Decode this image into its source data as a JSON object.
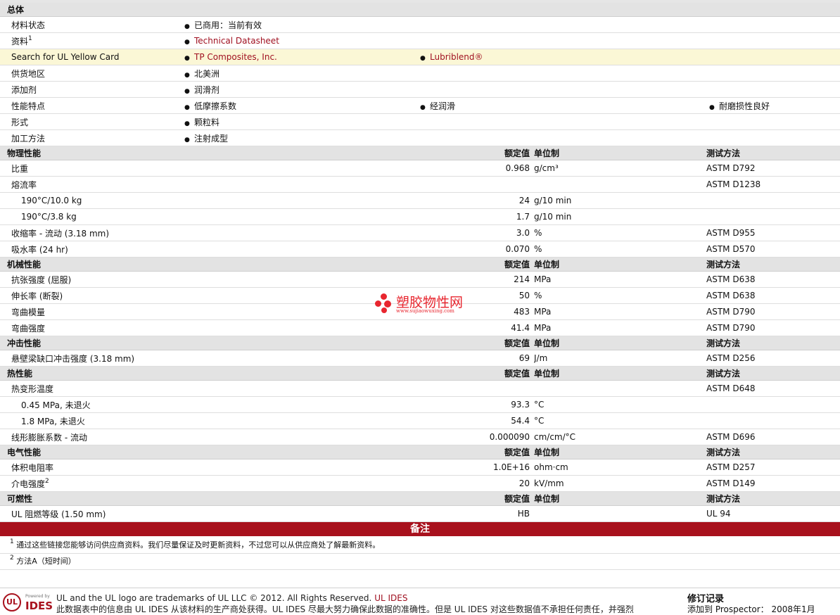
{
  "general": {
    "title": "总体",
    "rows": [
      {
        "name": "材料状态",
        "items": [
          "已商用：当前有效"
        ]
      },
      {
        "name": "资料",
        "sup": "1",
        "items": [
          "Technical Datasheet"
        ],
        "links": true
      },
      {
        "name": "Search for UL Yellow Card",
        "items": [
          "TP Composites, Inc.",
          "Lubriblend®"
        ],
        "links": true,
        "highlight": true
      },
      {
        "name": "供货地区",
        "items": [
          "北美洲"
        ]
      },
      {
        "name": "添加剂",
        "items": [
          "润滑剂"
        ]
      },
      {
        "name": "性能特点",
        "items": [
          "低摩擦系数",
          "经润滑",
          "耐磨损性良好"
        ]
      },
      {
        "name": "形式",
        "items": [
          "颗粒料"
        ]
      },
      {
        "name": "加工方法",
        "items": [
          "注射成型"
        ]
      }
    ]
  },
  "col_headers": {
    "value": "额定值",
    "unit": "单位制",
    "method": "测试方法"
  },
  "sections": [
    {
      "title": "物理性能",
      "rows": [
        {
          "name": "比重",
          "value": "0.968",
          "unit": "g/cm³",
          "method": "ASTM D792"
        },
        {
          "name": "熔流率",
          "value": "",
          "unit": "",
          "method": "ASTM D1238"
        },
        {
          "name": "190°C/10.0 kg",
          "sub": true,
          "value": "24",
          "unit": "g/10 min",
          "method": ""
        },
        {
          "name": "190°C/3.8 kg",
          "sub": true,
          "value": "1.7",
          "unit": "g/10 min",
          "method": ""
        },
        {
          "name": "收缩率  - 流动  (3.18 mm)",
          "value": "3.0",
          "unit": "%",
          "method": "ASTM D955"
        },
        {
          "name": "吸水率  (24 hr)",
          "value": "0.070",
          "unit": "%",
          "method": "ASTM D570"
        }
      ]
    },
    {
      "title": "机械性能",
      "rows": [
        {
          "name": "抗张强度  (屈服)",
          "value": "214",
          "unit": "MPa",
          "method": "ASTM D638"
        },
        {
          "name": "伸长率  (断裂)",
          "value": "50",
          "unit": "%",
          "method": "ASTM D638"
        },
        {
          "name": "弯曲模量",
          "value": "483",
          "unit": "MPa",
          "method": "ASTM D790"
        },
        {
          "name": "弯曲强度",
          "value": "41.4",
          "unit": "MPa",
          "method": "ASTM D790"
        }
      ]
    },
    {
      "title": "冲击性能",
      "rows": [
        {
          "name": "悬壁梁缺口冲击强度  (3.18 mm)",
          "value": "69",
          "unit": "J/m",
          "method": "ASTM D256"
        }
      ]
    },
    {
      "title": "热性能",
      "rows": [
        {
          "name": "热变形温度",
          "value": "",
          "unit": "",
          "method": "ASTM D648"
        },
        {
          "name": "0.45 MPa, 未退火",
          "sub": true,
          "value": "93.3",
          "unit": "°C",
          "method": ""
        },
        {
          "name": "1.8 MPa, 未退火",
          "sub": true,
          "value": "54.4",
          "unit": "°C",
          "method": ""
        },
        {
          "name": "线形膨胀系数  - 流动",
          "value": "0.000090",
          "unit": "cm/cm/°C",
          "method": "ASTM D696"
        }
      ]
    },
    {
      "title": "电气性能",
      "rows": [
        {
          "name": "体积电阻率",
          "value": "1.0E+16",
          "unit": "ohm·cm",
          "method": "ASTM D257"
        },
        {
          "name": "介电强度",
          "sup": "2",
          "value": "20",
          "unit": "kV/mm",
          "method": "ASTM D149"
        }
      ]
    },
    {
      "title": "可燃性",
      "rows": [
        {
          "name": "UL 阻燃等级  (1.50 mm)",
          "value": "HB",
          "unit": "",
          "method": "UL 94",
          "center": true
        }
      ]
    }
  ],
  "notes": {
    "title": "备注",
    "items": [
      {
        "num": "1",
        "text": "通过这些链接您能够访问供应商资料。我们尽量保证及时更新资料，不过您可以从供应商处了解最新资料。"
      },
      {
        "num": "2",
        "text": "方法A（短时间）"
      }
    ]
  },
  "watermark": {
    "title": "塑胶物性网",
    "url": "www.sujiaowuxing.com"
  },
  "footer": {
    "logo_ul": "UL",
    "logo_powered": "Powered by",
    "logo_ides": "IDES",
    "line1": "UL and the UL logo are trademarks of UL LLC © 2012. All Rights Reserved.",
    "line1_link": "UL IDES",
    "line2": "此数据表中的信息由 UL IDES 从该材料的生产商处获得。UL IDES 尽最大努力确保此数据的准确性。但是 UL IDES 对这些数据值不承担任何责任，并强烈",
    "revision_title": "修订记录",
    "revision_line": "添加到  Prospector：  2008年1月"
  },
  "colors": {
    "accent": "#a8111d",
    "link": "#a01020",
    "section_bg": "#e3e3e3",
    "highlight_bg": "#fbf7d6"
  }
}
